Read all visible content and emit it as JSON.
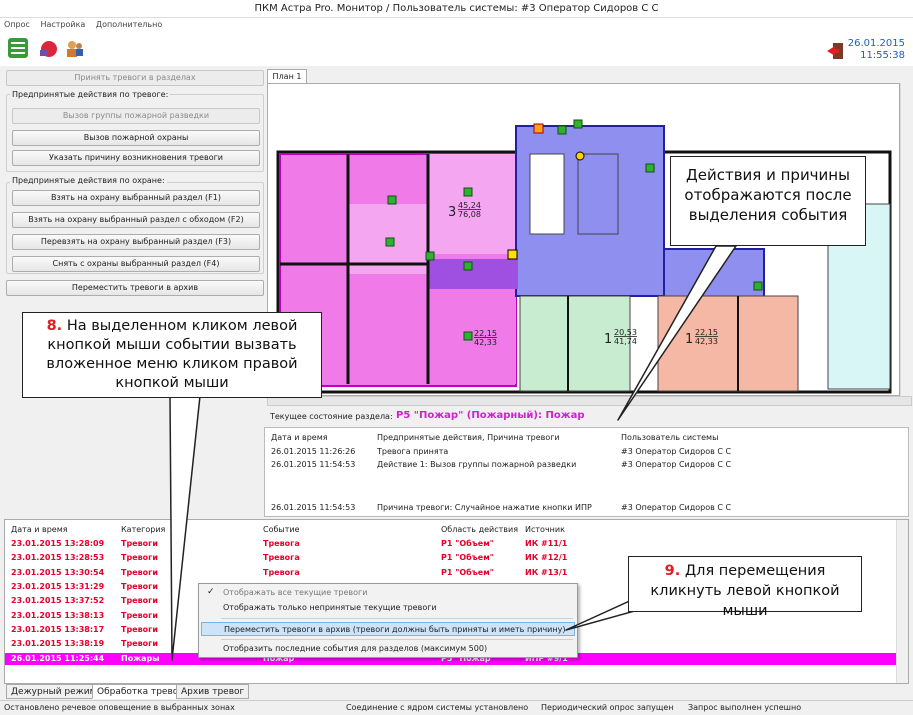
{
  "window": {
    "title": "ПКМ Астра Pro. Монитор / Пользователь системы: #3 Оператор Сидоров С С"
  },
  "menu": {
    "items": [
      "Опрос",
      "Настройка",
      "Дополнительно"
    ]
  },
  "toolbar": {
    "date": "26.01.2015",
    "time": "11:55:38"
  },
  "left": {
    "accept_btn": "Принять тревоги в разделах",
    "alarm_actions_label": "Предпринятые действия по тревоге:",
    "call_group_btn": "Вызов группы пожарной разведки",
    "call_fire_btn": "Вызов пожарной охраны",
    "reason_btn": "Указать причину возникновения тревоги",
    "guard_actions_label": "Предпринятые действия по охране:",
    "arm_btn": "Взять на охрану выбранный раздел (F1)",
    "arm_bypass_btn": "Взять на охрану выбранный раздел с обходом (F2)",
    "rearm_btn": "Перевзять на охрану выбранный раздел (F3)",
    "disarm_btn": "Снять с охраны выбранный раздел (F4)",
    "archive_btn": "Переместить тревоги в архив"
  },
  "plan": {
    "tab": "План 1",
    "rooms": [
      {
        "num": "3",
        "frac_top": "45,24",
        "frac_bot": "76,08"
      },
      {
        "num": "",
        "frac_top": "22,15",
        "frac_bot": "42,33"
      },
      {
        "num": "1",
        "frac_top": "20,53",
        "frac_bot": "41,74"
      },
      {
        "num": "1",
        "frac_top": "22,15",
        "frac_bot": "42,33"
      }
    ]
  },
  "state": {
    "label": "Текущее состояние раздела:",
    "value": "Р5 \"Пожар\" (Пожарный): Пожар"
  },
  "events": {
    "headers": [
      "Дата и время",
      "Предпринятые действия, Причина тревоги",
      "Пользователь системы"
    ],
    "rows": [
      [
        "26.01.2015 11:26:26",
        "Тревога принята",
        "#3 Оператор Сидоров С С"
      ],
      [
        "26.01.2015 11:54:53",
        "Действие 1: Вызов группы пожарной разведки",
        "#3 Оператор Сидоров С С"
      ],
      [
        "26.01.2015 11:54:53",
        "Причина тревоги: Случайное нажатие кнопки ИПР",
        "#3 Оператор Сидоров С С"
      ]
    ]
  },
  "alarms": {
    "headers": [
      "Дата и время",
      "Категория",
      "Событие",
      "Область действия",
      "Источник"
    ],
    "rows": [
      [
        "23.01.2015 13:28:09",
        "Тревоги",
        "Тревога",
        "Р1 \"Объем\"",
        "ИК #11/1"
      ],
      [
        "23.01.2015 13:28:53",
        "Тревоги",
        "Тревога",
        "Р1 \"Объем\"",
        "ИК #12/1"
      ],
      [
        "23.01.2015 13:30:54",
        "Тревоги",
        "Тревога",
        "Р1 \"Объем\"",
        "ИК #13/1"
      ],
      [
        "23.01.2015 13:31:29",
        "Тревоги",
        "",
        "",
        ""
      ],
      [
        "23.01.2015 13:37:52",
        "Тревоги",
        "",
        "",
        ""
      ],
      [
        "23.01.2015 13:38:13",
        "Тревоги",
        "",
        "",
        ""
      ],
      [
        "23.01.2015 13:38:17",
        "Тревоги",
        "",
        "",
        ""
      ],
      [
        "23.01.2015 13:38:19",
        "Тревоги",
        "",
        "",
        ""
      ]
    ],
    "selected": [
      "26.01.2015 11:25:44",
      "Пожары",
      "Пожар",
      "Р5 \"Пожар\"",
      "ИПР #9/1"
    ]
  },
  "context_menu": {
    "items": [
      "Отображать все текущие тревоги",
      "Отображать только непринятые текущие тревоги",
      "Переместить тревоги в архив (тревоги должны быть приняты и иметь причину)",
      "Отобразить последние события для разделов (максимум 500)"
    ]
  },
  "tabs": [
    "Дежурный режим",
    "Обработка тревог",
    "Архив тревог"
  ],
  "status": [
    "Остановлено речевое оповещение в выбранных зонах",
    "Соединение с ядром системы установлено",
    "Периодический опрос запущен",
    "Запрос выполнен успешно"
  ],
  "callouts": {
    "c1": "Действия и причины отображаются после выделения события",
    "c8_num": "8.",
    "c8": "На выделенном кликом левой кнопкой мыши событии вызвать вложенное меню кликом правой кнопкой мыши",
    "c9_num": "9.",
    "c9": "Для перемещения кликнуть левой кнопкой мыши"
  },
  "colors": {
    "alarm_red": "#e4002b",
    "selected_magenta": "#ff00ff",
    "state_magenta": "#d020d0"
  }
}
